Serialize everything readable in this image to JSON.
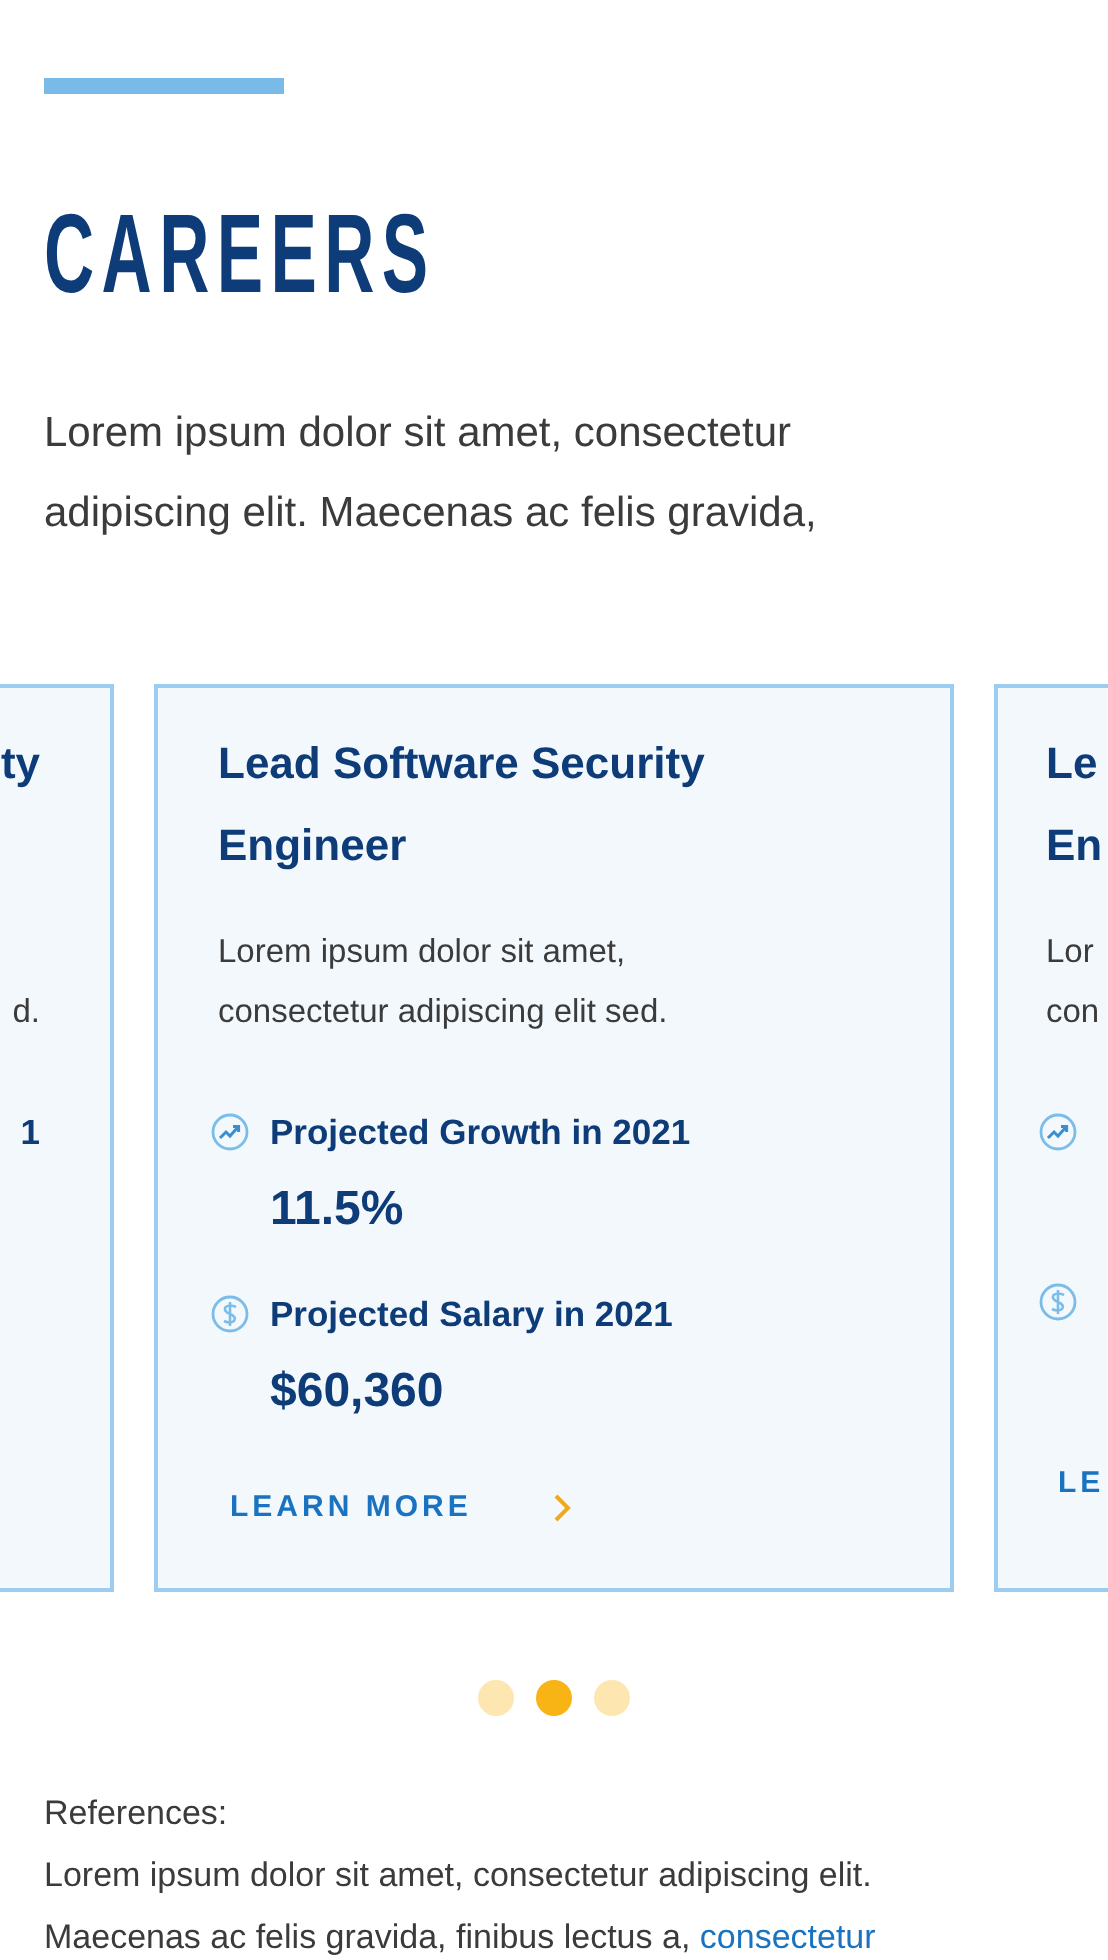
{
  "heading": "CAREERS",
  "intro_lines": [
    "Lorem ipsum dolor sit amet, consectetur",
    "adipiscing elit. Maecenas ac felis gravida,"
  ],
  "cards": [
    {
      "kind": "partial_left",
      "title_lines": [
        "ty"
      ],
      "description_lines": [
        "d."
      ],
      "stats": [
        {
          "label": "1"
        }
      ]
    },
    {
      "kind": "full",
      "title_lines": [
        "Lead Software Security",
        "Engineer"
      ],
      "description_lines": [
        "Lorem ipsum dolor sit amet,",
        "consectetur adipiscing elit sed."
      ],
      "stats": [
        {
          "kind": "growth",
          "label": "Projected Growth in 2021",
          "value": "11.5%"
        },
        {
          "kind": "salary",
          "label": "Projected Salary in 2021",
          "value": "$60,360"
        }
      ],
      "link": "LEARN MORE"
    },
    {
      "kind": "partial_right",
      "title_lines": [
        "Le",
        "En"
      ],
      "description_lines": [
        "Lor",
        "con"
      ],
      "stats": [
        {
          "kind": "growth"
        },
        {
          "kind": "salary"
        }
      ],
      "link": "LE"
    }
  ],
  "dots": [
    {
      "selected": false
    },
    {
      "selected": true
    },
    {
      "selected": false
    }
  ],
  "references": {
    "label": "References:",
    "lines": [
      "Lorem ipsum dolor sit amet, consectetur adipiscing elit.",
      "Maecenas ac felis gravida, finibus lectus a,"
    ],
    "link": "consectetur"
  }
}
